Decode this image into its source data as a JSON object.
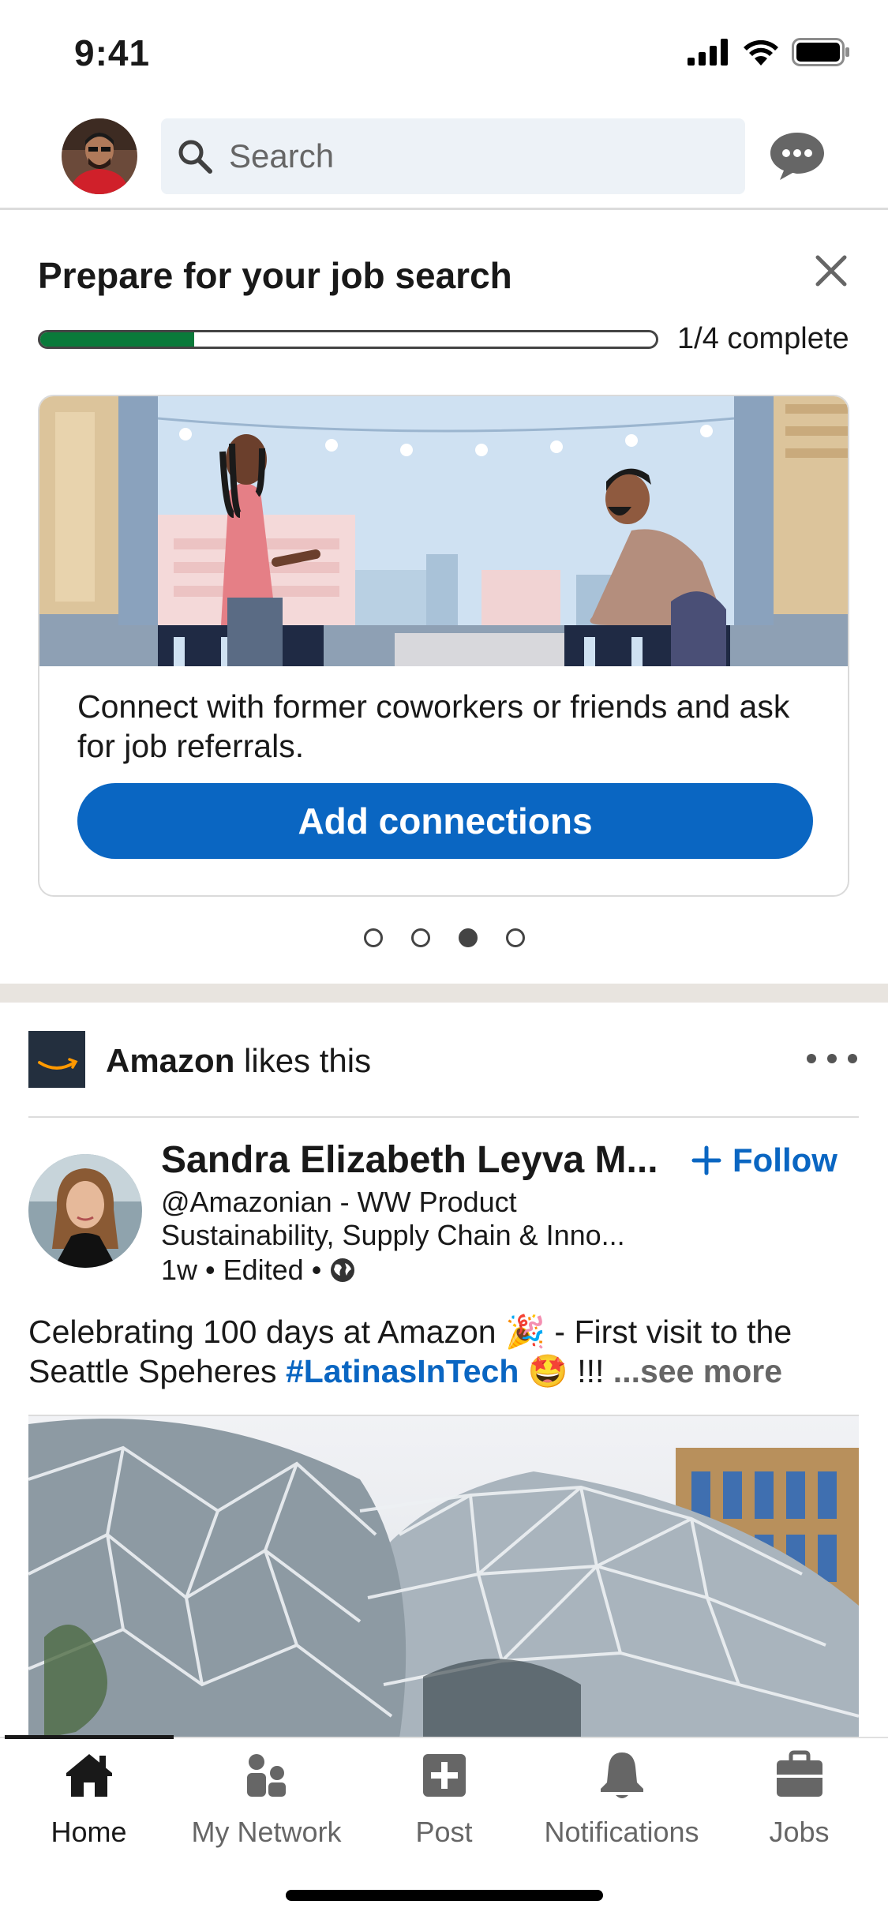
{
  "status_bar": {
    "time": "9:41"
  },
  "header": {
    "search_placeholder": "Search"
  },
  "job_card": {
    "title": "Prepare for your job search",
    "progress_fraction": 0.25,
    "progress_label": "1/4 complete",
    "description": "Connect with former coworkers or friends and ask for job referrals.",
    "button_label": "Add connections",
    "carousel": {
      "count": 4,
      "active_index": 2
    }
  },
  "post": {
    "likes_company": "Amazon",
    "likes_suffix": " likes this",
    "author_name": "Sandra Elizabeth Leyva M...",
    "follow_label": "Follow",
    "author_headline": "@Amazonian - WW Product Sustainability, Supply Chain & Inno...",
    "author_meta": "1w • Edited •",
    "text_part1": "Celebrating 100 days at Amazon 🎉 - First visit to the Seattle Speheres ",
    "hashtag": "#LatinasInTech",
    "text_part2": " 🤩 !!!  ",
    "see_more": "...see more"
  },
  "bottom_nav": {
    "items": [
      {
        "label": "Home",
        "icon": "home-icon",
        "active": true
      },
      {
        "label": "My Network",
        "icon": "my-network-icon",
        "active": false
      },
      {
        "label": "Post",
        "icon": "post-icon",
        "active": false
      },
      {
        "label": "Notifications",
        "icon": "bell-icon",
        "active": false
      },
      {
        "label": "Jobs",
        "icon": "briefcase-icon",
        "active": false
      }
    ]
  },
  "colors": {
    "brand_blue": "#0a66c2",
    "progress_green": "#0a7a3a",
    "amazon_navy": "#232f3e"
  }
}
